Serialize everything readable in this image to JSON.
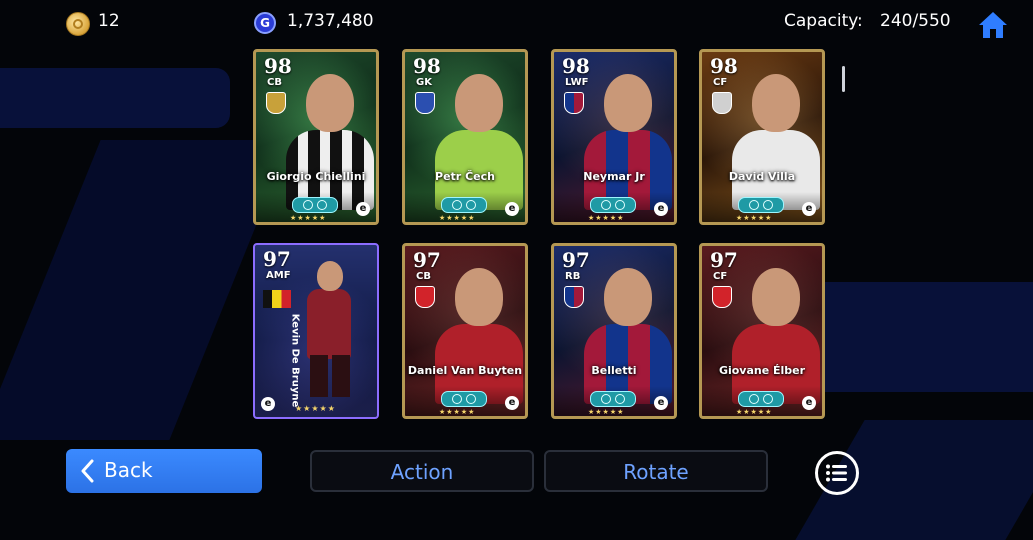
{
  "header": {
    "coins": "12",
    "gp": "1,737,480",
    "capacity_label": "Capacity:",
    "capacity_value": "240/550"
  },
  "cards": [
    {
      "rating": "98",
      "position": "CB",
      "name": "Giorgio Chiellini"
    },
    {
      "rating": "98",
      "position": "GK",
      "name": "Petr Čech"
    },
    {
      "rating": "98",
      "position": "LWF",
      "name": "Neymar Jr"
    },
    {
      "rating": "98",
      "position": "CF",
      "name": "David Villa"
    },
    {
      "rating": "97",
      "position": "AMF",
      "name": "Kevin De Bruyne"
    },
    {
      "rating": "97",
      "position": "CB",
      "name": "Daniel Van Buyten"
    },
    {
      "rating": "97",
      "position": "RB",
      "name": "Belletti"
    },
    {
      "rating": "97",
      "position": "CF",
      "name": "Giovane Élber"
    }
  ],
  "footer": {
    "back_label": "Back",
    "action_label": "Action",
    "rotate_label": "Rotate"
  },
  "colors": {
    "accent": "#3b8aff",
    "button_text": "#6ea2ff",
    "card_border": "#b59853",
    "special_card_border": "#8c6dff"
  },
  "icons": [
    "coin-icon",
    "gp-icon",
    "home-icon",
    "chevron-left-icon",
    "list-icon"
  ]
}
